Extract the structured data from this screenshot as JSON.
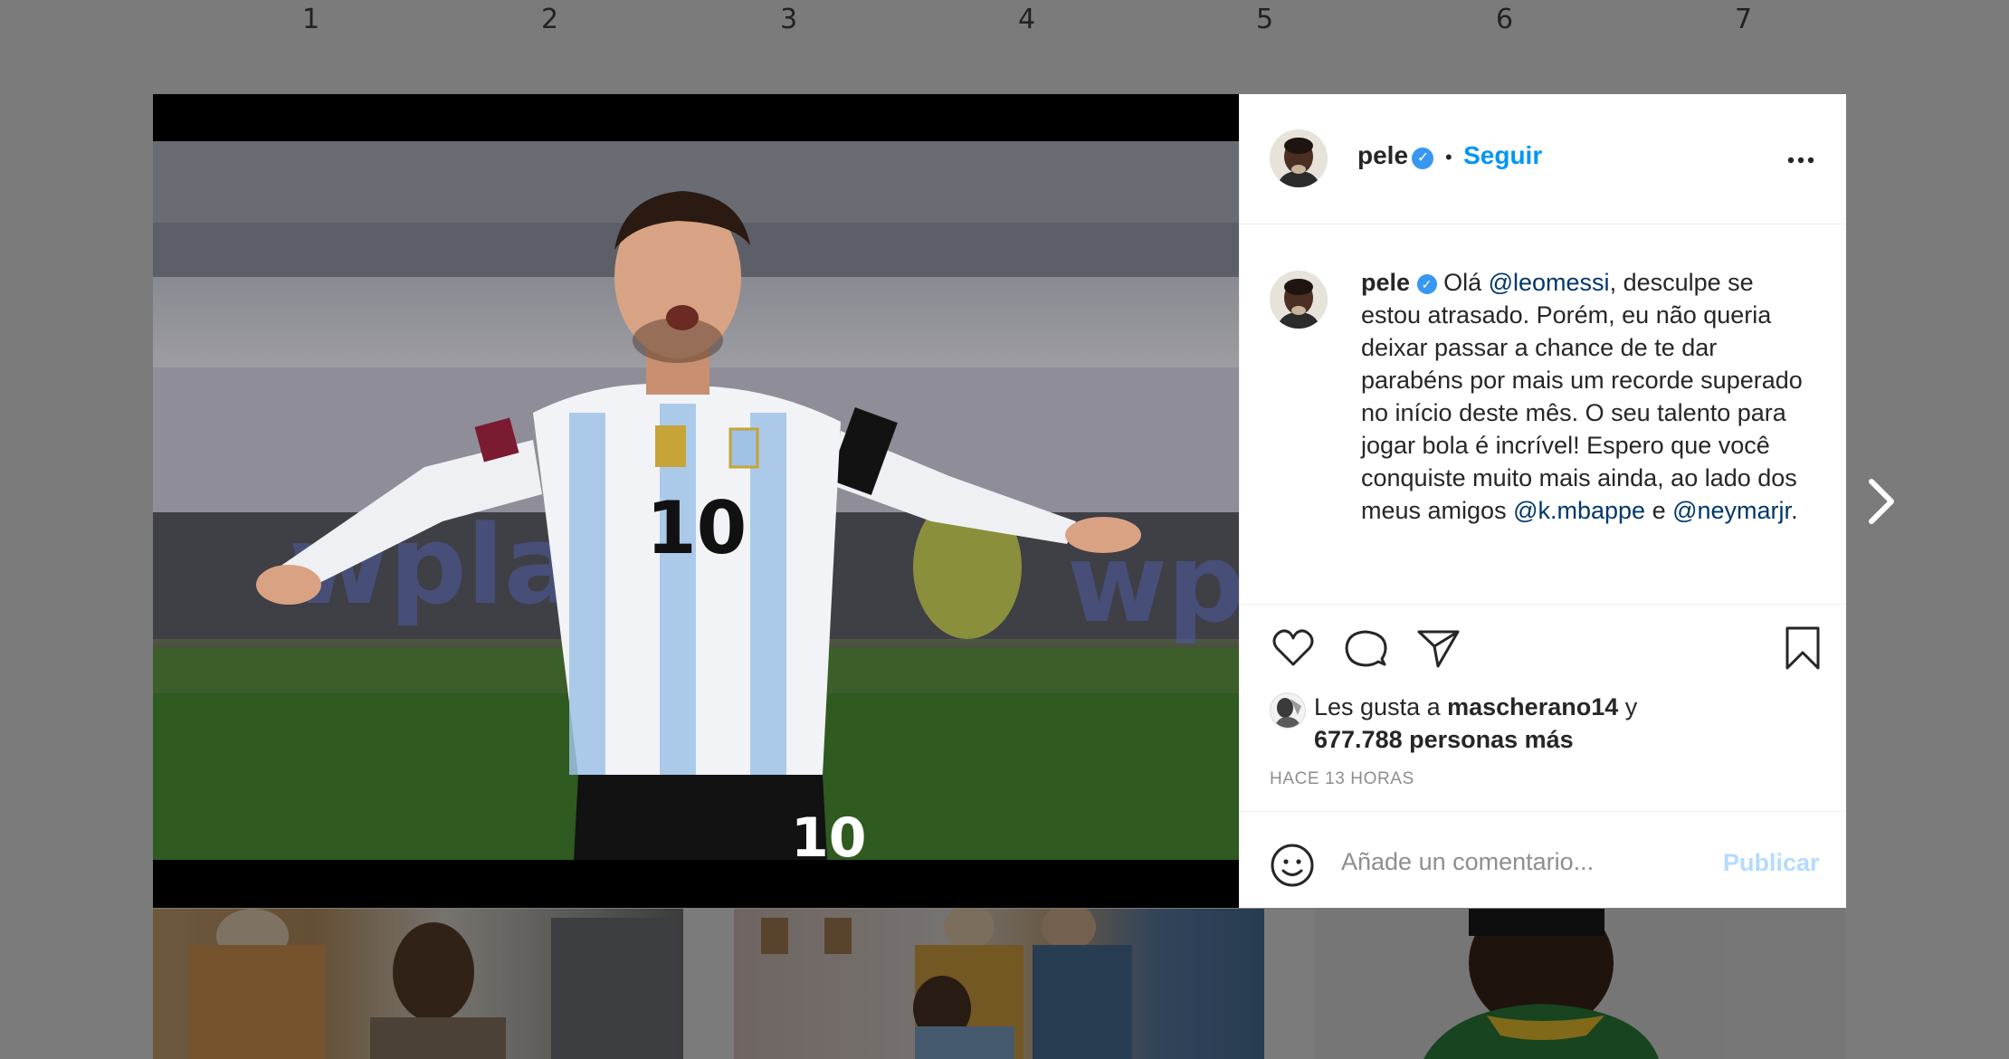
{
  "ruler": [
    "1",
    "2",
    "3",
    "4",
    "5",
    "6",
    "7"
  ],
  "post": {
    "username": "pele",
    "verified_icon": "verified-badge-icon",
    "separator": "•",
    "follow_label": "Seguir",
    "more_icon": "more-options-icon",
    "caption": {
      "username": "pele",
      "text_1": "Olá",
      "mention_1": "@leomessi",
      "text_2": ", desculpe se estou atrasado. Porém, eu não queria deixar passar a chance de te dar parabéns por mais um recorde superado no início deste mês. O seu talento para jogar bola é incrível! Espero que você conquiste muito mais ainda, ao lado dos meus amigos",
      "mention_2": "@k.mbappe",
      "text_3": " e ",
      "mention_3": "@neymarjr",
      "text_4": "."
    },
    "likes": {
      "prefix": "Les gusta a",
      "user": "mascherano14",
      "joiner": "y",
      "count": "677.788 personas más"
    },
    "time": "HACE 13 HORAS",
    "comment": {
      "placeholder": "Añade un comentario...",
      "publish_label": "Publicar"
    }
  },
  "colors": {
    "accent": "#0095f6",
    "mention": "#00376b",
    "publish_disabled": "#b3dbff",
    "verified": "#3897f0"
  }
}
